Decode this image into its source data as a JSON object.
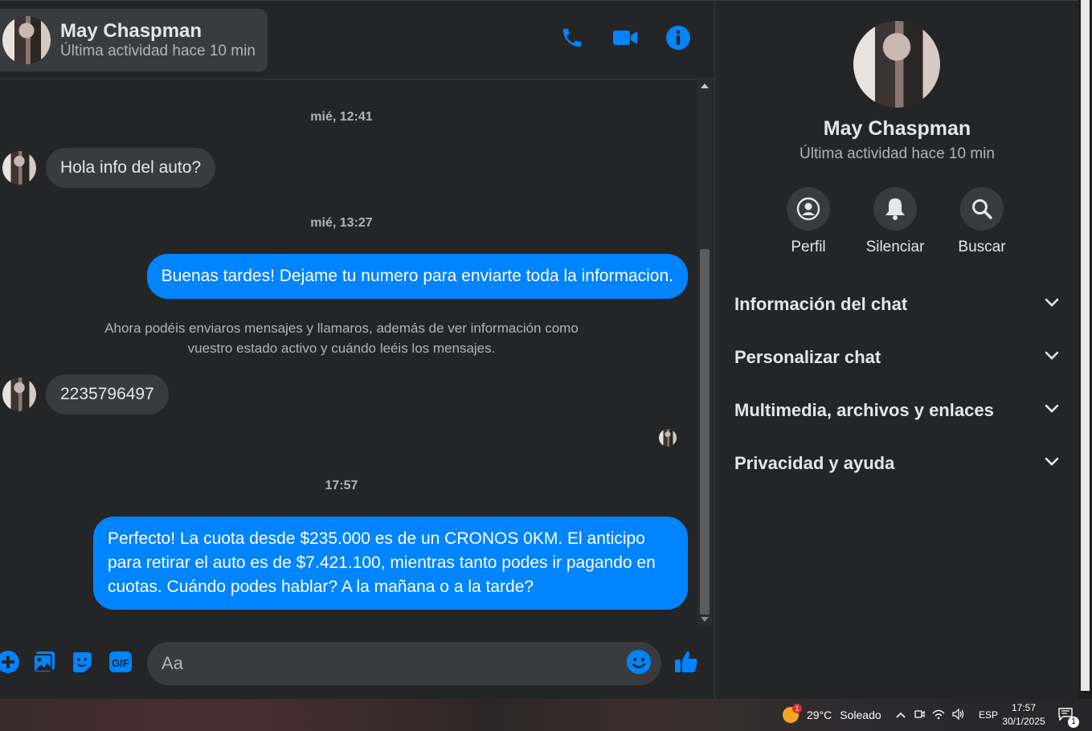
{
  "header": {
    "name": "May Chaspman",
    "status": "Última actividad hace 10 min",
    "actions": [
      "phone-icon",
      "video-camera-icon",
      "info-icon"
    ]
  },
  "messages": {
    "ts1": "mié, 12:41",
    "m1": "Hola info del auto?",
    "ts2": "mié, 13:27",
    "m2": "Buenas tardes! Dejame tu numero para enviarte toda la informacion.",
    "note": "Ahora podéis enviaros mensajes y llamaros, además de ver información como vuestro estado activo y cuándo leéis los mensajes.",
    "m3": "2235796497",
    "ts3": "17:57",
    "m4": "Perfecto! La cuota desde $235.000 es de un CRONOS 0KM. El anticipo para retirar el auto es de $7.421.100, mientras tanto podes ir pagando en cuotas. Cuándo podes hablar? A la mañana o a la tarde?"
  },
  "composer": {
    "placeholder": "Aa",
    "icons": [
      "plus-icon",
      "photo-icon",
      "sticker-icon",
      "gif-icon",
      "emoji-icon",
      "like-icon"
    ]
  },
  "panel": {
    "name": "May Chaspman",
    "status": "Última actividad hace 10 min",
    "quick": [
      {
        "label": "Perfil",
        "icon": "profile-icon"
      },
      {
        "label": "Silenciar",
        "icon": "bell-icon"
      },
      {
        "label": "Buscar",
        "icon": "search-icon"
      }
    ],
    "sections": [
      "Información del chat",
      "Personalizar chat",
      "Multimedia, archivos y enlaces",
      "Privacidad y ayuda"
    ]
  },
  "taskbar": {
    "weather": "29°C",
    "condition": "Soleado",
    "weather_badge": "1",
    "lang": "ESP",
    "time": "17:57",
    "date": "30/1/2025",
    "notifications": "1"
  },
  "colors": {
    "accent": "#0084ff",
    "background": "#242526",
    "bubble_in": "#3a3b3c"
  }
}
